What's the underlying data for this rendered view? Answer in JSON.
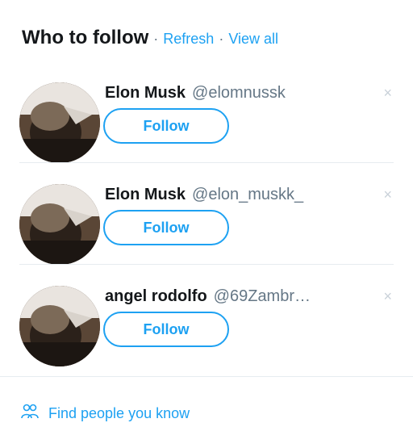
{
  "header": {
    "title": "Who to follow",
    "separator": "·",
    "refresh_label": "Refresh",
    "view_all_label": "View all"
  },
  "suggestions": [
    {
      "name": "Elon Musk",
      "handle": "@elomnussk",
      "follow_label": "Follow",
      "dismiss": "×"
    },
    {
      "name": "Elon Musk",
      "handle": "@elon_muskk_",
      "follow_label": "Follow",
      "dismiss": "×"
    },
    {
      "name": "angel rodolfo",
      "handle": "@69Zambr…",
      "follow_label": "Follow",
      "dismiss": "×"
    }
  ],
  "footer": {
    "icon": "people-icon",
    "label": "Find people you know"
  },
  "colors": {
    "accent": "#1da1f2",
    "text": "#14171a",
    "secondary": "#657786",
    "divider": "#e6ecf0"
  }
}
